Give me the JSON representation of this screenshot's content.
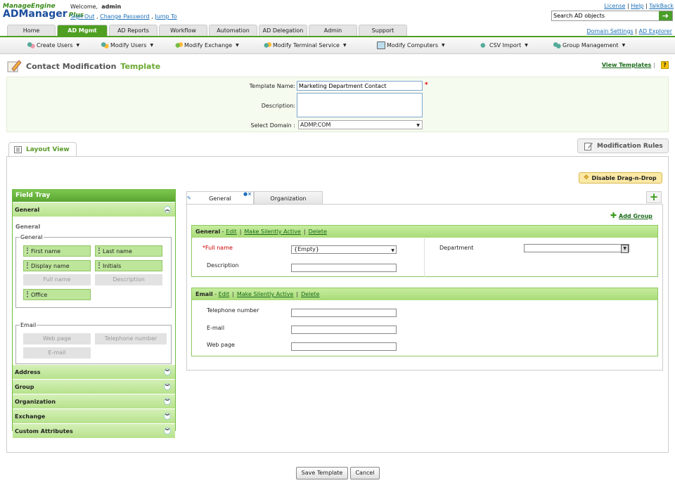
{
  "app": {
    "brand_top": "ManageEngine",
    "brand_main": "ADManager",
    "brand_plus": "Plus"
  },
  "user": {
    "welcome": "Welcome,",
    "name": "admin",
    "sign_out": "Sign Out",
    "change_password": "Change Password",
    "jump_to": "Jump To"
  },
  "toplinks": {
    "license": "License",
    "help": "Help",
    "talkback": "TalkBack"
  },
  "search": {
    "value": "Search AD objects"
  },
  "tabs": [
    {
      "label": "Home"
    },
    {
      "label": "AD Mgmt"
    },
    {
      "label": "AD Reports"
    },
    {
      "label": "Workflow"
    },
    {
      "label": "Automation"
    },
    {
      "label": "AD Delegation"
    },
    {
      "label": "Admin"
    },
    {
      "label": "Support"
    }
  ],
  "rightlinks": {
    "domain_settings": "Domain Settings",
    "ad_explorer": "AD Explorer"
  },
  "submenu": [
    {
      "label": "Create Users"
    },
    {
      "label": "Modify Users"
    },
    {
      "label": "Modify Exchange"
    },
    {
      "label": "Modify Terminal Service"
    },
    {
      "label": "Modify Computers"
    },
    {
      "label": "CSV Import"
    },
    {
      "label": "Group Management"
    }
  ],
  "page": {
    "title_a": "Contact Modification",
    "title_b": "Template",
    "view_templates": "View Templates",
    "help": "?"
  },
  "form": {
    "template_name_label": "Template Name:",
    "template_name_value": "Marketing Department Contact",
    "description_label": "Description:",
    "description_value": "",
    "domain_label": "Select Domain :",
    "domain_value": "ADMP.COM",
    "required_mark": "*"
  },
  "layout": {
    "layout_view": "Layout View",
    "modification_rules": "Modification Rules",
    "disable_dnd": "Disable Drag-n-Drop"
  },
  "tray": {
    "title": "Field Tray",
    "general_header": "General",
    "general_title": "General",
    "group_general": "General",
    "group_email": "Email",
    "fields_general": [
      "First name",
      "Last name",
      "Display name",
      "Initials",
      "Full name",
      "Description",
      "Office"
    ],
    "fields_email": [
      "Web page",
      "Telephone number",
      "E-mail"
    ],
    "collapsed": [
      "Address",
      "Group",
      "Organization",
      "Exchange",
      "Custom Attributes"
    ]
  },
  "content": {
    "tab_general": "General",
    "tab_organization": "Organization",
    "add_group": "Add Group",
    "sections": [
      {
        "title": "General",
        "edit": "Edit",
        "silent": "Make Silently Active",
        "delete": "Delete"
      },
      {
        "title": "Email",
        "edit": "Edit",
        "silent": "Make Silently Active",
        "delete": "Delete"
      }
    ],
    "general_fields": {
      "full_name": "Full name",
      "full_name_value": "{Empty}",
      "description": "Description",
      "department": "Department",
      "required_mark": "*"
    },
    "email_fields": {
      "telephone": "Telephone number",
      "email": "E-mail",
      "web_page": "Web page"
    }
  },
  "buttons": {
    "save": "Save Template",
    "cancel": "Cancel"
  }
}
